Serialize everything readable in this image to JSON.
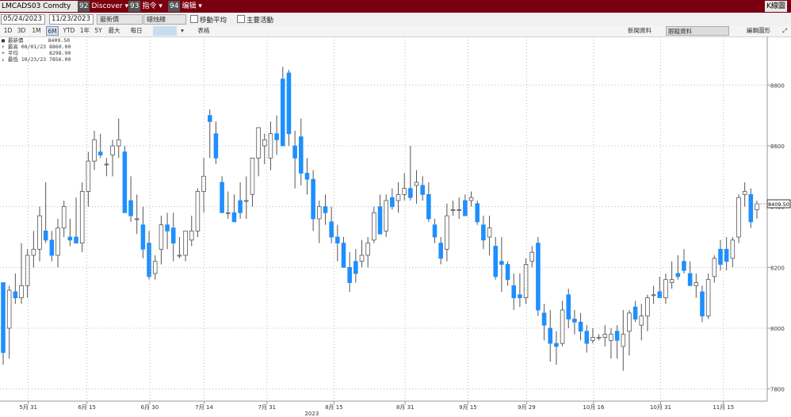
{
  "toolbar": {
    "ticker": "LMCADS03 Comdty",
    "discover_label": "Discover",
    "actions_label": "指令",
    "edit_label": "编辑",
    "right_label": "K線圖"
  },
  "controls": {
    "start_date": "05/24/2023",
    "end_date": "11/23/2023",
    "field": "最新價",
    "style": "蜡烛線",
    "moving_avg_label": "移動平均",
    "key_events_label": "主要活動",
    "news_label": "新聞資料",
    "tracking_label": "跟蹤資料",
    "edit_chart_label": "編輯圖形"
  },
  "periods": [
    "1D",
    "3D",
    "1M",
    "6M",
    "YTD",
    "1年",
    "5Y",
    "最大",
    "每日"
  ],
  "active_period": "6M",
  "table_label": "表格",
  "legend": {
    "last_label": "最新價",
    "last_value": "8409.50",
    "high_label": "最高",
    "high_date": "08/01/23",
    "high_value": "8860.00",
    "avg_label": "平均",
    "avg_value": "8298.90",
    "low_label": "最低",
    "low_date": "10/23/23",
    "low_value": "7856.00"
  },
  "chart_data": {
    "type": "candlestick",
    "ylim": [
      7760,
      8960
    ],
    "y_ticks": [
      7800,
      8000,
      8200,
      8400,
      8600,
      8800
    ],
    "last_price": "8409.50",
    "x_ticks": [
      "5月 31",
      "6月 15",
      "6月 30",
      "7月 14",
      "7月 31",
      "8月 15",
      "8月 31",
      "9月 15",
      "9月 29",
      "10月 16",
      "10月 31",
      "11月 15"
    ],
    "year_label": "2023",
    "up_color": "#ffffff",
    "down_color": "#1e8fff",
    "ohlc": [
      {
        "o": 8150,
        "h": 8150,
        "l": 7880,
        "c": 7920
      },
      {
        "o": 8000,
        "h": 8140,
        "l": 7900,
        "c": 8125
      },
      {
        "o": 8120,
        "h": 8180,
        "l": 8080,
        "c": 8100
      },
      {
        "o": 8100,
        "h": 8280,
        "l": 8080,
        "c": 8140
      },
      {
        "o": 8140,
        "h": 8260,
        "l": 8100,
        "c": 8240
      },
      {
        "o": 8240,
        "h": 8320,
        "l": 8200,
        "c": 8260
      },
      {
        "o": 8260,
        "h": 8400,
        "l": 8220,
        "c": 8370
      },
      {
        "o": 8320,
        "h": 8480,
        "l": 8280,
        "c": 8290
      },
      {
        "o": 8290,
        "h": 8320,
        "l": 8220,
        "c": 8240
      },
      {
        "o": 8240,
        "h": 8360,
        "l": 8200,
        "c": 8330
      },
      {
        "o": 8330,
        "h": 8420,
        "l": 8300,
        "c": 8400
      },
      {
        "o": 8300,
        "h": 8360,
        "l": 8270,
        "c": 8290
      },
      {
        "o": 8300,
        "h": 8430,
        "l": 8280,
        "c": 8280
      },
      {
        "o": 8280,
        "h": 8480,
        "l": 8250,
        "c": 8450
      },
      {
        "o": 8450,
        "h": 8580,
        "l": 8400,
        "c": 8550
      },
      {
        "o": 8550,
        "h": 8650,
        "l": 8520,
        "c": 8620
      },
      {
        "o": 8580,
        "h": 8640,
        "l": 8560,
        "c": 8570
      },
      {
        "o": 8540,
        "h": 8560,
        "l": 8500,
        "c": 8540
      },
      {
        "o": 8570,
        "h": 8620,
        "l": 8500,
        "c": 8600
      },
      {
        "o": 8600,
        "h": 8690,
        "l": 8560,
        "c": 8620
      },
      {
        "o": 8580,
        "h": 8600,
        "l": 8380,
        "c": 8380
      },
      {
        "o": 8420,
        "h": 8500,
        "l": 8350,
        "c": 8370
      },
      {
        "o": 8360,
        "h": 8440,
        "l": 8310,
        "c": 8360
      },
      {
        "o": 8340,
        "h": 8400,
        "l": 8230,
        "c": 8260
      },
      {
        "o": 8280,
        "h": 8320,
        "l": 8160,
        "c": 8170
      },
      {
        "o": 8180,
        "h": 8240,
        "l": 8160,
        "c": 8220
      },
      {
        "o": 8260,
        "h": 8370,
        "l": 8210,
        "c": 8340
      },
      {
        "o": 8340,
        "h": 8380,
        "l": 8260,
        "c": 8320
      },
      {
        "o": 8330,
        "h": 8380,
        "l": 8220,
        "c": 8280
      },
      {
        "o": 8240,
        "h": 8300,
        "l": 8230,
        "c": 8240
      },
      {
        "o": 8240,
        "h": 8320,
        "l": 8220,
        "c": 8320
      },
      {
        "o": 8290,
        "h": 8370,
        "l": 8270,
        "c": 8320
      },
      {
        "o": 8320,
        "h": 8460,
        "l": 8300,
        "c": 8450
      },
      {
        "o": 8450,
        "h": 8560,
        "l": 8380,
        "c": 8500
      },
      {
        "o": 8700,
        "h": 8720,
        "l": 8560,
        "c": 8680
      },
      {
        "o": 8640,
        "h": 8680,
        "l": 8540,
        "c": 8560
      },
      {
        "o": 8480,
        "h": 8500,
        "l": 8420,
        "c": 8380
      },
      {
        "o": 8380,
        "h": 8450,
        "l": 8360,
        "c": 8380
      },
      {
        "o": 8380,
        "h": 8440,
        "l": 8360,
        "c": 8350
      },
      {
        "o": 8420,
        "h": 8480,
        "l": 8360,
        "c": 8380
      },
      {
        "o": 8420,
        "h": 8500,
        "l": 8360,
        "c": 8420
      },
      {
        "o": 8440,
        "h": 8560,
        "l": 8400,
        "c": 8560
      },
      {
        "o": 8560,
        "h": 8660,
        "l": 8500,
        "c": 8660
      },
      {
        "o": 8600,
        "h": 8640,
        "l": 8540,
        "c": 8620
      },
      {
        "o": 8560,
        "h": 8680,
        "l": 8520,
        "c": 8640
      },
      {
        "o": 8640,
        "h": 8700,
        "l": 8570,
        "c": 8620
      },
      {
        "o": 8820,
        "h": 8860,
        "l": 8640,
        "c": 8600
      },
      {
        "o": 8840,
        "h": 8850,
        "l": 8600,
        "c": 8640
      },
      {
        "o": 8600,
        "h": 8650,
        "l": 8460,
        "c": 8560
      },
      {
        "o": 8630,
        "h": 8690,
        "l": 8470,
        "c": 8510
      },
      {
        "o": 8510,
        "h": 8560,
        "l": 8440,
        "c": 8490
      },
      {
        "o": 8490,
        "h": 8520,
        "l": 8320,
        "c": 8360
      },
      {
        "o": 8360,
        "h": 8420,
        "l": 8280,
        "c": 8400
      },
      {
        "o": 8400,
        "h": 8440,
        "l": 8340,
        "c": 8380
      },
      {
        "o": 8350,
        "h": 8400,
        "l": 8280,
        "c": 8300
      },
      {
        "o": 8300,
        "h": 8340,
        "l": 8220,
        "c": 8280
      },
      {
        "o": 8280,
        "h": 8300,
        "l": 8200,
        "c": 8200
      },
      {
        "o": 8200,
        "h": 8250,
        "l": 8120,
        "c": 8150
      },
      {
        "o": 8220,
        "h": 8260,
        "l": 8150,
        "c": 8180
      },
      {
        "o": 8220,
        "h": 8290,
        "l": 8200,
        "c": 8240
      },
      {
        "o": 8240,
        "h": 8300,
        "l": 8200,
        "c": 8280
      },
      {
        "o": 8290,
        "h": 8400,
        "l": 8280,
        "c": 8380
      },
      {
        "o": 8400,
        "h": 8440,
        "l": 8350,
        "c": 8310
      },
      {
        "o": 8320,
        "h": 8440,
        "l": 8300,
        "c": 8420
      },
      {
        "o": 8430,
        "h": 8460,
        "l": 8390,
        "c": 8400
      },
      {
        "o": 8420,
        "h": 8480,
        "l": 8380,
        "c": 8440
      },
      {
        "o": 8440,
        "h": 8510,
        "l": 8420,
        "c": 8460
      },
      {
        "o": 8460,
        "h": 8600,
        "l": 8420,
        "c": 8430
      },
      {
        "o": 8470,
        "h": 8520,
        "l": 8410,
        "c": 8480
      },
      {
        "o": 8470,
        "h": 8500,
        "l": 8420,
        "c": 8440
      },
      {
        "o": 8440,
        "h": 8480,
        "l": 8350,
        "c": 8360
      },
      {
        "o": 8340,
        "h": 8360,
        "l": 8280,
        "c": 8300
      },
      {
        "o": 8280,
        "h": 8300,
        "l": 8210,
        "c": 8230
      },
      {
        "o": 8260,
        "h": 8410,
        "l": 8220,
        "c": 8370
      },
      {
        "o": 8390,
        "h": 8420,
        "l": 8370,
        "c": 8390
      },
      {
        "o": 8390,
        "h": 8430,
        "l": 8360,
        "c": 8390
      },
      {
        "o": 8420,
        "h": 8440,
        "l": 8370,
        "c": 8370
      },
      {
        "o": 8420,
        "h": 8450,
        "l": 8400,
        "c": 8430
      },
      {
        "o": 8410,
        "h": 8420,
        "l": 8340,
        "c": 8350
      },
      {
        "o": 8340,
        "h": 8370,
        "l": 8260,
        "c": 8290
      },
      {
        "o": 8300,
        "h": 8370,
        "l": 8240,
        "c": 8330
      },
      {
        "o": 8270,
        "h": 8300,
        "l": 8160,
        "c": 8170
      },
      {
        "o": 8220,
        "h": 8300,
        "l": 8120,
        "c": 8210
      },
      {
        "o": 8210,
        "h": 8220,
        "l": 8140,
        "c": 8160
      },
      {
        "o": 8140,
        "h": 8180,
        "l": 8060,
        "c": 8100
      },
      {
        "o": 8110,
        "h": 8180,
        "l": 8070,
        "c": 8100
      },
      {
        "o": 8100,
        "h": 8230,
        "l": 8080,
        "c": 8210
      },
      {
        "o": 8220,
        "h": 8270,
        "l": 8200,
        "c": 8250
      },
      {
        "o": 8280,
        "h": 8300,
        "l": 8040,
        "c": 8060
      },
      {
        "o": 8050,
        "h": 8080,
        "l": 7960,
        "c": 8010
      },
      {
        "o": 8000,
        "h": 8060,
        "l": 7890,
        "c": 7950
      },
      {
        "o": 7950,
        "h": 7990,
        "l": 7880,
        "c": 7940
      },
      {
        "o": 7950,
        "h": 8090,
        "l": 7940,
        "c": 8060
      },
      {
        "o": 8110,
        "h": 8130,
        "l": 8000,
        "c": 8030
      },
      {
        "o": 8030,
        "h": 8060,
        "l": 7980,
        "c": 8020
      },
      {
        "o": 8020,
        "h": 8050,
        "l": 7960,
        "c": 7990
      },
      {
        "o": 7990,
        "h": 8010,
        "l": 7920,
        "c": 7950
      },
      {
        "o": 7960,
        "h": 8000,
        "l": 7950,
        "c": 7970
      },
      {
        "o": 7970,
        "h": 7980,
        "l": 7960,
        "c": 7970
      },
      {
        "o": 7970,
        "h": 8010,
        "l": 7940,
        "c": 7980
      },
      {
        "o": 7960,
        "h": 8000,
        "l": 7900,
        "c": 7980
      },
      {
        "o": 7990,
        "h": 8010,
        "l": 7900,
        "c": 7960
      },
      {
        "o": 7940,
        "h": 8060,
        "l": 7860,
        "c": 7980
      },
      {
        "o": 7990,
        "h": 8060,
        "l": 7910,
        "c": 8050
      },
      {
        "o": 8070,
        "h": 8090,
        "l": 8020,
        "c": 8030
      },
      {
        "o": 8010,
        "h": 8080,
        "l": 7960,
        "c": 8040
      },
      {
        "o": 8040,
        "h": 8110,
        "l": 7990,
        "c": 8100
      },
      {
        "o": 8110,
        "h": 8140,
        "l": 8080,
        "c": 8110
      },
      {
        "o": 8120,
        "h": 8170,
        "l": 8100,
        "c": 8100
      },
      {
        "o": 8100,
        "h": 8180,
        "l": 8080,
        "c": 8160
      },
      {
        "o": 8150,
        "h": 8220,
        "l": 8130,
        "c": 8160
      },
      {
        "o": 8180,
        "h": 8240,
        "l": 8160,
        "c": 8170
      },
      {
        "o": 8220,
        "h": 8260,
        "l": 8180,
        "c": 8190
      },
      {
        "o": 8180,
        "h": 8220,
        "l": 8140,
        "c": 8140
      },
      {
        "o": 8140,
        "h": 8180,
        "l": 8100,
        "c": 8150
      },
      {
        "o": 8120,
        "h": 8140,
        "l": 8020,
        "c": 8040
      },
      {
        "o": 8040,
        "h": 8180,
        "l": 8030,
        "c": 8160
      },
      {
        "o": 8170,
        "h": 8240,
        "l": 8150,
        "c": 8230
      },
      {
        "o": 8260,
        "h": 8290,
        "l": 8190,
        "c": 8210
      },
      {
        "o": 8260,
        "h": 8300,
        "l": 8190,
        "c": 8220
      },
      {
        "o": 8230,
        "h": 8300,
        "l": 8200,
        "c": 8290
      },
      {
        "o": 8300,
        "h": 8440,
        "l": 8280,
        "c": 8430
      },
      {
        "o": 8440,
        "h": 8480,
        "l": 8400,
        "c": 8450
      },
      {
        "o": 8440,
        "h": 8460,
        "l": 8330,
        "c": 8350
      },
      {
        "o": 8390,
        "h": 8420,
        "l": 8360,
        "c": 8409.5
      }
    ]
  }
}
